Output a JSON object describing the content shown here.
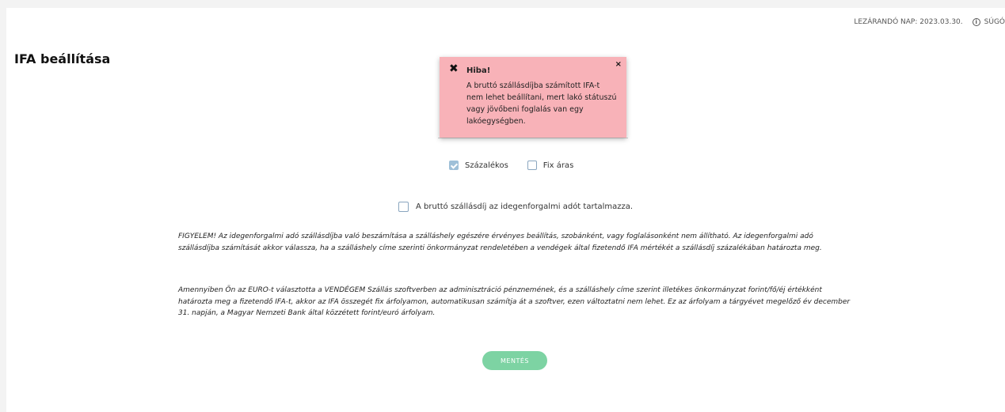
{
  "header": {
    "closing_day": "LEZÁRANDÓ NAP: 2023.03.30.",
    "help_icon": "ⓘ",
    "help_label": "SÚGÓ"
  },
  "page": {
    "title": "IFA beállítása"
  },
  "toast": {
    "icon": "✖",
    "close": "×",
    "title": "Hiba!",
    "message": "A bruttó szállásdíjba számított IFA-t nem lehet beállítani, mert lakó státuszú vagy jövőbeni foglalás van egy lakóegységben."
  },
  "options": {
    "percent_label": "Százalékos",
    "percent_checked": true,
    "fixed_label": "Fix áras",
    "fixed_checked": false
  },
  "tax_include": {
    "label": "A bruttó szállásdíj az idegenforgalmi adót tartalmazza.",
    "checked": false
  },
  "notes": {
    "note1": "FIGYELEM! Az idegenforgalmi adó szállásdíjba való beszámítása a szálláshely egészére érvényes beállítás, szobánként, vagy foglalásonként nem állítható. Az idegenforgalmi adó szállásdíjba számítását akkor válassza, ha a szálláshely címe szerinti önkormányzat rendeletében a vendégek által fizetendő IFA mértékét a szállásdíj százalékában határozta meg.",
    "note2": "Amennyiben Ön az EURO-t választotta a VENDÉGEM Szállás szoftverben az adminisztráció pénznemének, és a szálláshely címe szerint illetékes önkormányzat forint/fő/éj értékként határozta meg a fizetendő IFA-t, akkor az IFA összegét fix árfolyamon, automatikusan számítja át a szoftver, ezen változtatni nem lehet. Ez az árfolyam a tárgyévet megelőző év december 31. napján, a Magyar Nemzeti Bank által közzétett forint/euró árfolyam."
  },
  "actions": {
    "save_label": "MENTÉS"
  },
  "colors": {
    "toast_bg": "#f8b2b8",
    "save_bg": "#7dd3a3",
    "checkbox_checked": "#9fc0d8"
  }
}
